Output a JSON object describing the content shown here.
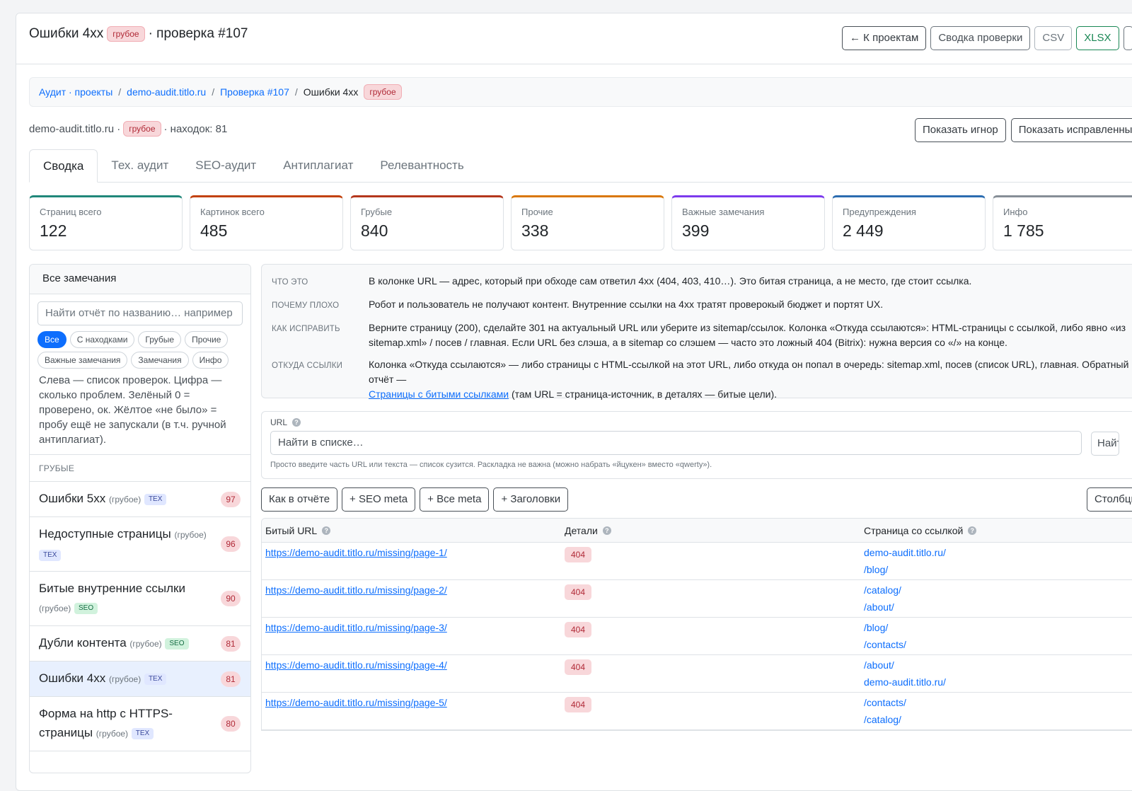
{
  "header": {
    "title": "Ошибки 4xx",
    "severity": "грубое",
    "subtitle": "· проверка #107",
    "buttons": {
      "back": "← К проектам",
      "summary": "Сводка проверки",
      "csv": "CSV",
      "xlsx": "XLSX"
    }
  },
  "breadcrumb": {
    "items": [
      "Аудит · проекты",
      "demo-audit.titlo.ru",
      "Проверка #107"
    ],
    "current": "Ошибки 4xx",
    "badge": "грубое",
    "separator": "/"
  },
  "info": {
    "site": "demo-audit.titlo.ru ·",
    "badge": "грубое",
    "findings": "· находок: 81",
    "show_ignored": "Показать игнор",
    "show_fixed": "Показать исправленные"
  },
  "tabs": [
    "Сводка",
    "Тех. аудит",
    "SEO-аудит",
    "Антиплагиат",
    "Релевантность"
  ],
  "stats": [
    {
      "label": "Страниц всего",
      "value": "122",
      "color": "#20877a"
    },
    {
      "label": "Картинок всего",
      "value": "485",
      "color": "#c2410c"
    },
    {
      "label": "Грубые",
      "value": "840",
      "color": "#b4361c"
    },
    {
      "label": "Прочие",
      "value": "338",
      "color": "#d97706"
    },
    {
      "label": "Важные замечания",
      "value": "399",
      "color": "#7c3aed"
    },
    {
      "label": "Предупреждения",
      "value": "2 449",
      "color": "#2b6cb0"
    },
    {
      "label": "Инфо",
      "value": "1 785",
      "color": "#868e96"
    }
  ],
  "sidebar": {
    "title": "Все замечания",
    "search_placeholder": "Найти отчёт по названию… например",
    "chips": [
      "Все",
      "С находками",
      "Грубые",
      "Прочие",
      "Важные замечания",
      "Замечания",
      "Инфо"
    ],
    "help": "Слева — список проверок. Цифра — сколько проблем. Зелёный 0 = проверено, ок. Жёлтое «не было» = пробу ещё не запускали (в т.ч. ручной антиплагиат).",
    "group": "ГРУБЫЕ",
    "items": [
      {
        "label": "Ошибки 5xx",
        "note": "(грубое)",
        "tag": "TEX",
        "count": "97"
      },
      {
        "label": "Недоступные страницы",
        "note": "(грубое)",
        "tag": "TEX",
        "count": "96"
      },
      {
        "label": "Битые внутренние ссылки",
        "note": "(грубое)",
        "tag": "SEO",
        "count": "90"
      },
      {
        "label": "Дубли контента",
        "note": "(грубое)",
        "tag": "SEO",
        "count": "81"
      },
      {
        "label": "Ошибки 4xx",
        "note": "(грубое)",
        "tag": "TEX",
        "count": "81"
      },
      {
        "label": "Форма на http с HTTPS-страницы",
        "note": "(грубое)",
        "tag": "TEX",
        "count": "80"
      }
    ]
  },
  "description": {
    "what_k": "ЧТО ЭТО",
    "what_v": "В колонке URL — адрес, который при обходе сам ответил 4xx (404, 403, 410…). Это битая страница, а не место, где стоит ссылка.",
    "why_k": "ПОЧЕМУ ПЛОХО",
    "why_v": "Робот и пользователь не получают контент. Внутренние ссылки на 4xx тратят проверокый бюджет и портят UX.",
    "fix_k": "КАК ИСПРАВИТЬ",
    "fix_v": "Верните страницу (200), сделайте 301 на актуальный URL или уберите из sitemap/ссылок. Колонка «Откуда ссылаются»: HTML-страницы с ссылкой, либо явно «из sitemap.xml» / посев / главная. Если URL без слэша, а в sitemap со слэшем — часто это ложный 404 (Bitrix): нужна версия со «/» на конце.",
    "from_k": "ОТКУДА ССЫЛКИ",
    "from_v": "Колонка «Откуда ссылаются» — либо страницы с HTML-ссылкой на этот URL, либо откуда он попал в очередь: sitemap.xml, посев (список URL), главная. Обратный отчёт —",
    "from_link": "Страницы с битыми ссылками",
    "from_tail": " (там URL = страница-источник, в деталях — битые цели)."
  },
  "filter": {
    "label": "URL",
    "placeholder": "Найти в списке…",
    "side_btn": "Найти",
    "hint": "Просто введите часть URL или текста — список сузится. Раскладка не важна (можно набрать «йцукен» вместо «qwerty»)."
  },
  "column_buttons": [
    "Как в отчёте",
    "+ SEO meta",
    "+ Все meta",
    "+ Заголовки"
  ],
  "columns_btn": "Столбцы",
  "table": {
    "headers": [
      "Битый URL",
      "Детали",
      "Страница со ссылкой"
    ],
    "rows": [
      {
        "url": "https://demo-audit.titlo.ru/missing/page-1/",
        "code": "404",
        "ref1": "demo-audit.titlo.ru/",
        "ref2": "/blog/"
      },
      {
        "url": "https://demo-audit.titlo.ru/missing/page-2/",
        "code": "404",
        "ref1": "/catalog/",
        "ref2": "/about/"
      },
      {
        "url": "https://demo-audit.titlo.ru/missing/page-3/",
        "code": "404",
        "ref1": "/blog/",
        "ref2": "/contacts/"
      },
      {
        "url": "https://demo-audit.titlo.ru/missing/page-4/",
        "code": "404",
        "ref1": "/about/",
        "ref2": "demo-audit.titlo.ru/"
      },
      {
        "url": "https://demo-audit.titlo.ru/missing/page-5/",
        "code": "404",
        "ref1": "/contacts/",
        "ref2": "/catalog/"
      }
    ]
  }
}
